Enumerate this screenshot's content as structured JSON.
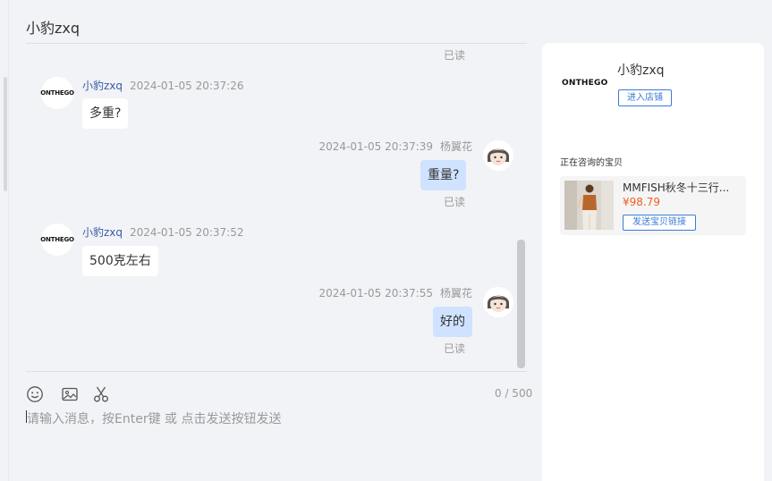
{
  "chat": {
    "title": "小豹zxq",
    "read_label": "已读",
    "messages": [
      {
        "sender": "小豹zxq",
        "time": "2024-01-05 20:37:26",
        "text": "多重?"
      },
      {
        "sender": "杨翼花",
        "time": "2024-01-05 20:37:39",
        "text": "重量?"
      },
      {
        "sender": "小豹zxq",
        "time": "2024-01-05 20:37:52",
        "text": "500克左右"
      },
      {
        "sender": "杨翼花",
        "time": "2024-01-05 20:37:55",
        "text": "好的"
      }
    ],
    "shop_avatar_text": "ONTHEGO"
  },
  "input": {
    "counter": "0 / 500",
    "placeholder": "请输入消息，按Enter键 或 点击发送按钮发送",
    "tools": [
      "emoji-icon",
      "image-icon",
      "scissors-icon"
    ]
  },
  "panel": {
    "logo_text": "ONTHEGO",
    "shop_name": "小豹zxq",
    "enter_store_label": "进入店铺",
    "consulting_label": "正在咨询的宝贝",
    "product": {
      "title": "MMFISH秋冬十三行...",
      "price": "¥98.79",
      "send_link_label": "发送宝贝链接"
    }
  },
  "colors": {
    "accent": "#3a7bd5",
    "price": "#f25c24",
    "outgoing_bubble": "#cfe2ff",
    "background": "#f2f3f6"
  }
}
